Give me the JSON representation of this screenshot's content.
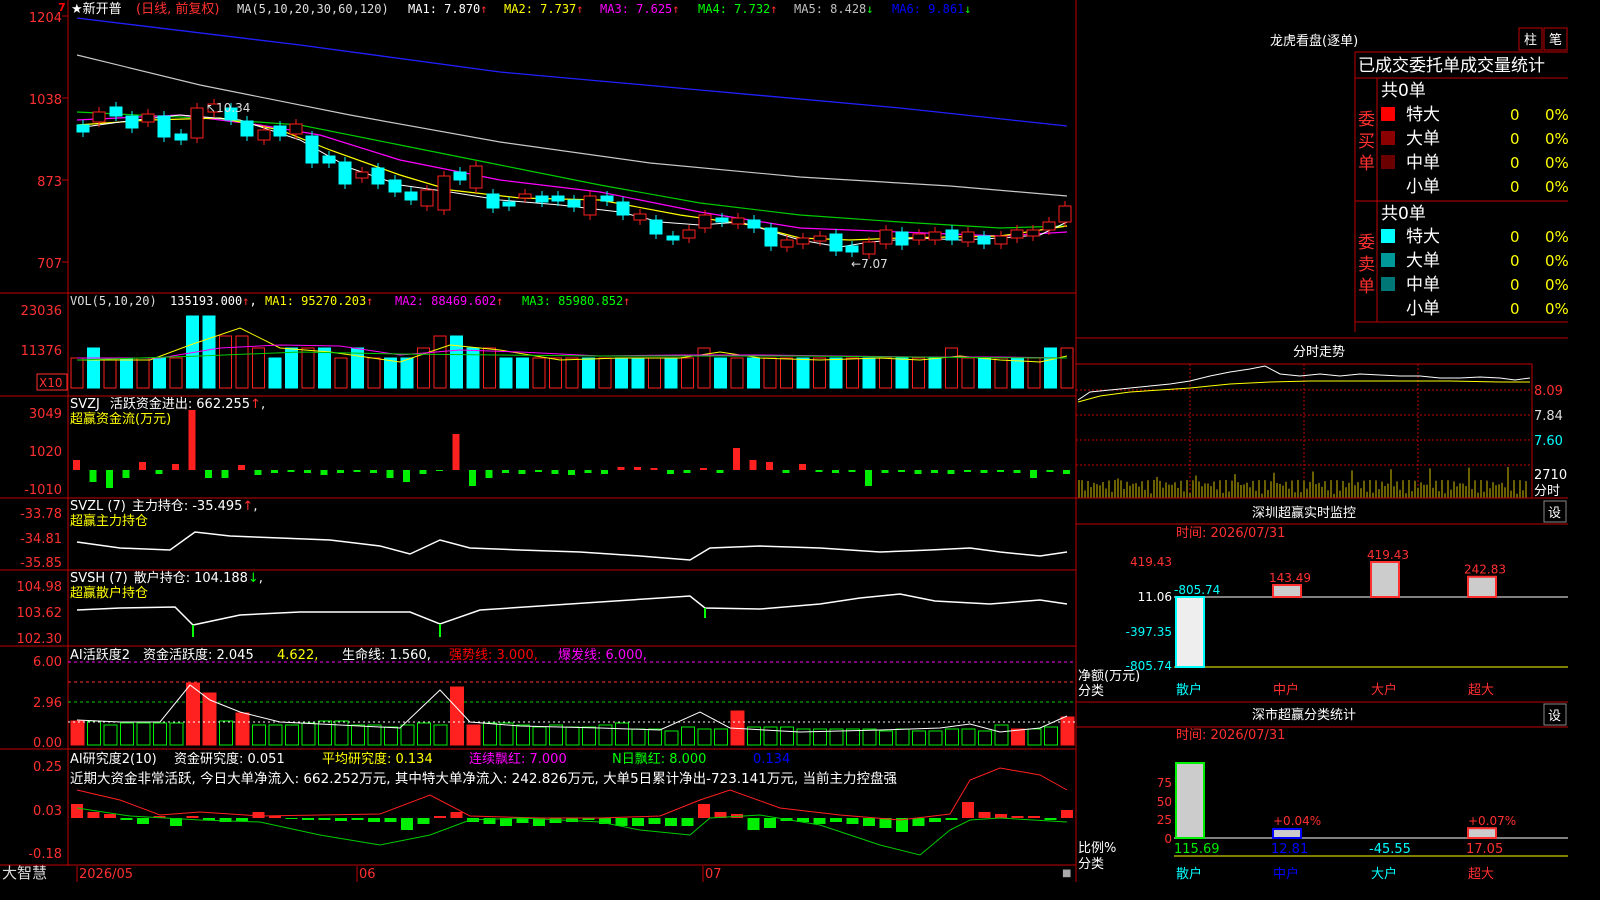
{
  "stock": {
    "name": "★新开普",
    "period_label": "(日线, 前复权)",
    "ma_label": "MA(5,10,20,30,60,120)",
    "ma_values": [
      {
        "name": "MA1",
        "value": "7.870",
        "dir": "↑",
        "color": "#ffffff"
      },
      {
        "name": "MA2",
        "value": "7.737",
        "dir": "↑",
        "color": "#ffff00"
      },
      {
        "name": "MA3",
        "value": "7.625",
        "dir": "↑",
        "color": "#ff00ff"
      },
      {
        "name": "MA4",
        "value": "7.732",
        "dir": "↑",
        "color": "#00ff00"
      },
      {
        "name": "MA5",
        "value": "8.428",
        "dir": "↓",
        "color": "#c0c0c0"
      },
      {
        "name": "MA6",
        "value": "9.861",
        "dir": "↓",
        "color": "#0000ff"
      }
    ],
    "hi_label": "10.34",
    "lo_label": "7.07",
    "price_ticks": [
      "1204",
      "1038",
      "873",
      "707"
    ],
    "mark": "7"
  },
  "vol": {
    "label": "VOL(5,10,20)",
    "value": "135193.000",
    "ma": [
      {
        "name": "MA1",
        "value": "95270.203",
        "color": "#ffff00"
      },
      {
        "name": "MA2",
        "value": "88469.602",
        "color": "#ff00ff"
      },
      {
        "name": "MA3",
        "value": "85980.852",
        "color": "#00ff00"
      }
    ],
    "ticks": [
      "23036",
      "11376"
    ],
    "unit": "X10"
  },
  "svzj": {
    "label": "SVZJ",
    "title": "活跃资金进出:",
    "value": "662.255",
    "sub": "超赢资金流(万元)",
    "ticks": [
      "3049",
      "1020",
      "-1010"
    ]
  },
  "svzl": {
    "label": "SVZL (7)",
    "title": "主力持仓:",
    "value": "-35.495",
    "sub": "超赢主力持仓",
    "ticks": [
      "-33.78",
      "-34.81",
      "-35.85"
    ]
  },
  "svsh": {
    "label": "SVSH (7)",
    "title": "散户持仓:",
    "value": "104.188",
    "sub": "超赢散户持仓",
    "ticks": [
      "104.98",
      "103.62",
      "102.30"
    ]
  },
  "ai1": {
    "label": "AI活跃度2",
    "items": [
      {
        "text": "资金活跃度: 2.045",
        "color": "#ffffff"
      },
      {
        "text": "4.622,",
        "color": "#ffff00"
      },
      {
        "text": "生命线: 1.560,",
        "color": "#ffffff"
      },
      {
        "text": "强势线: 3.000,",
        "color": "#ff0000"
      },
      {
        "text": "爆发线: 6.000,",
        "color": "#ff00ff"
      }
    ],
    "ticks": [
      "6.00",
      "2.96",
      "0.00"
    ]
  },
  "ai2": {
    "label": "AI研究度2(10)",
    "items": [
      {
        "text": "资金研究度: 0.051",
        "color": "#ffffff"
      },
      {
        "text": "平均研究度: 0.134",
        "color": "#ffff00"
      },
      {
        "text": "连续飘红: 7.000",
        "color": "#ff00ff"
      },
      {
        "text": "N日飘红: 8.000",
        "color": "#00ff00"
      },
      {
        "text": "0.134",
        "color": "#0000ff"
      }
    ],
    "summary": "近期大资金非常活跃, 今日大单净流入: 662.252万元, 其中特大单净流入: 242.826万元, 大单5日累计净出-723.141万元, 当前主力控盘强",
    "ticks": [
      "0.25",
      "0.03",
      "-0.18"
    ]
  },
  "dates": [
    "2026/05",
    "06",
    "07"
  ],
  "brand": "大智慧",
  "right": {
    "lhb_title": "龙虎看盘(逐单)",
    "btn_zhu": "柱",
    "btn_bi": "笔",
    "stats_header": "已成交委托单成交量统计",
    "buy_side": "委买单",
    "sell_side": "委卖单",
    "buy_total": "共0单",
    "sell_total": "共0单",
    "buy_rows": [
      {
        "label": "特大",
        "count": "0",
        "pct": "0%",
        "color": "#ff0000"
      },
      {
        "label": "大单",
        "count": "0",
        "pct": "0%",
        "color": "#8b0000"
      },
      {
        "label": "中单",
        "count": "0",
        "pct": "0%",
        "color": "#6b0000"
      },
      {
        "label": "小单",
        "count": "0",
        "pct": "0%",
        "color": ""
      }
    ],
    "sell_rows": [
      {
        "label": "特大",
        "count": "0",
        "pct": "0%",
        "color": "#00ffff"
      },
      {
        "label": "大单",
        "count": "0",
        "pct": "0%",
        "color": "#009999"
      },
      {
        "label": "中单",
        "count": "0",
        "pct": "0%",
        "color": "#007777"
      },
      {
        "label": "小单",
        "count": "0",
        "pct": "0%",
        "color": ""
      }
    ],
    "intraday_title": "分时走势",
    "intraday_ticks": [
      "8.09",
      "7.84",
      "7.60"
    ],
    "intraday_vol": "2710",
    "intraday_unit": "分时",
    "monitor_title": "深圳超赢实时监控",
    "monitor_btn": "设",
    "monitor_time": "时间: 2026/07/31",
    "monitor_ticks": [
      "419.43",
      "11.06",
      "-397.35",
      "-805.74"
    ],
    "monitor_axis_label": "净额(万元)",
    "monitor_cat_label": "分类",
    "classify_title": "深市超赢分类统计",
    "classify_btn": "设",
    "classify_time": "时间: 2026/07/31",
    "classify_ticks": [
      "75",
      "50",
      "25",
      "0"
    ],
    "classify_axis_label": "比例%",
    "classify_cat_label": "分类"
  },
  "chart_data": [
    {
      "type": "bar",
      "title": "深圳超赢实时监控",
      "categories": [
        "散户",
        "中户",
        "大户",
        "超大"
      ],
      "values": [
        -805.74,
        143.49,
        419.43,
        242.83
      ],
      "ylabel": "净额(万元)",
      "ylim": [
        -805.74,
        419.43
      ]
    },
    {
      "type": "bar",
      "title": "深市超赢分类统计",
      "categories": [
        "散户",
        "中户",
        "大户",
        "超大"
      ],
      "values": [
        115.69,
        12.81,
        -45.55,
        17.05
      ],
      "bar_labels": [
        "",
        "+0.04%",
        "",
        "+0.07%"
      ],
      "ylabel": "比例%",
      "ylim": [
        0,
        75
      ]
    }
  ]
}
